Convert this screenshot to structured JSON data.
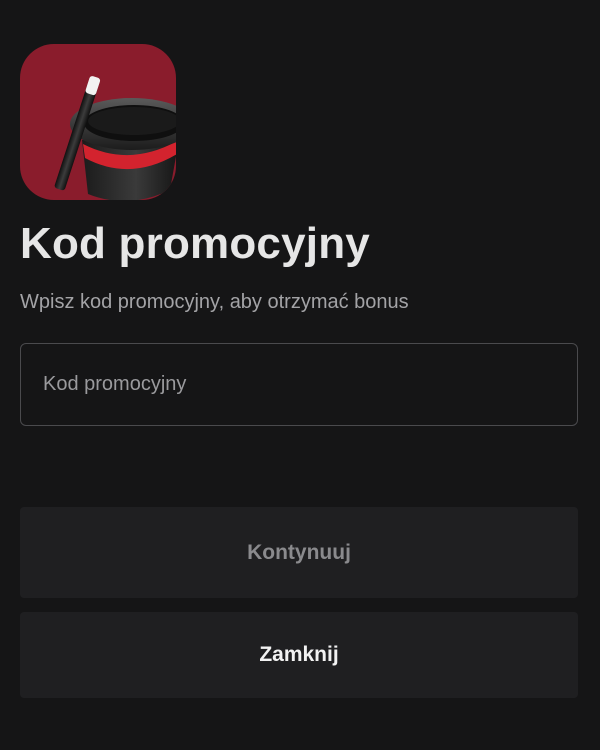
{
  "app_icon": {
    "name": "magic-hat-wand-icon",
    "background_color": "#8a1c2c"
  },
  "title": "Kod promocyjny",
  "subtitle": "Wpisz kod promocyjny, aby otrzymać bonus",
  "promo_input": {
    "placeholder": "Kod promocyjny",
    "value": ""
  },
  "buttons": {
    "continue_label": "Kontynuuj",
    "close_label": "Zamknij"
  },
  "colors": {
    "background": "#151516",
    "title_text": "#e6e6e6",
    "subtitle_text": "#a3a3a6",
    "button_background": "#1f1f21",
    "disabled_button_text": "#8a8a8d"
  }
}
